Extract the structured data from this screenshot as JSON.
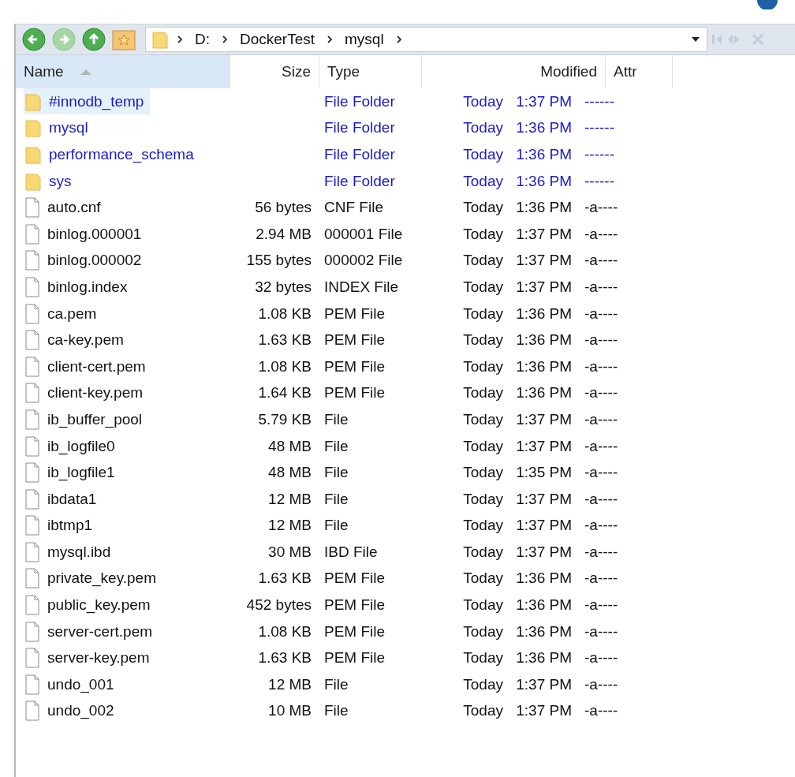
{
  "address_bar": {
    "segments": [
      "D:",
      "DockerTest",
      "mysql"
    ]
  },
  "columns": [
    {
      "label": "Name",
      "sorted": true
    },
    {
      "label": "Size",
      "sorted": false
    },
    {
      "label": "Type",
      "sorted": false
    },
    {
      "label": "Modified",
      "sorted": false
    },
    {
      "label": "Attr",
      "sorted": false
    }
  ],
  "rows": [
    {
      "kind": "folder",
      "name": "#innodb_temp",
      "size": "",
      "type": "File Folder",
      "date": "Today",
      "time": "1:37 PM",
      "attr": "------",
      "selected": true
    },
    {
      "kind": "folder",
      "name": "mysql",
      "size": "",
      "type": "File Folder",
      "date": "Today",
      "time": "1:36 PM",
      "attr": "------",
      "selected": false
    },
    {
      "kind": "folder",
      "name": "performance_schema",
      "size": "",
      "type": "File Folder",
      "date": "Today",
      "time": "1:36 PM",
      "attr": "------",
      "selected": false
    },
    {
      "kind": "folder",
      "name": "sys",
      "size": "",
      "type": "File Folder",
      "date": "Today",
      "time": "1:36 PM",
      "attr": "------",
      "selected": false
    },
    {
      "kind": "file",
      "name": "auto.cnf",
      "size": "56 bytes",
      "type": "CNF File",
      "date": "Today",
      "time": "1:36 PM",
      "attr": "-a----",
      "selected": false
    },
    {
      "kind": "file",
      "name": "binlog.000001",
      "size": "2.94 MB",
      "type": "000001 File",
      "date": "Today",
      "time": "1:37 PM",
      "attr": "-a----",
      "selected": false
    },
    {
      "kind": "file",
      "name": "binlog.000002",
      "size": "155 bytes",
      "type": "000002 File",
      "date": "Today",
      "time": "1:37 PM",
      "attr": "-a----",
      "selected": false
    },
    {
      "kind": "file",
      "name": "binlog.index",
      "size": "32 bytes",
      "type": "INDEX File",
      "date": "Today",
      "time": "1:37 PM",
      "attr": "-a----",
      "selected": false
    },
    {
      "kind": "file",
      "name": "ca.pem",
      "size": "1.08 KB",
      "type": "PEM File",
      "date": "Today",
      "time": "1:36 PM",
      "attr": "-a----",
      "selected": false
    },
    {
      "kind": "file",
      "name": "ca-key.pem",
      "size": "1.63 KB",
      "type": "PEM File",
      "date": "Today",
      "time": "1:36 PM",
      "attr": "-a----",
      "selected": false
    },
    {
      "kind": "file",
      "name": "client-cert.pem",
      "size": "1.08 KB",
      "type": "PEM File",
      "date": "Today",
      "time": "1:36 PM",
      "attr": "-a----",
      "selected": false
    },
    {
      "kind": "file",
      "name": "client-key.pem",
      "size": "1.64 KB",
      "type": "PEM File",
      "date": "Today",
      "time": "1:36 PM",
      "attr": "-a----",
      "selected": false
    },
    {
      "kind": "file",
      "name": "ib_buffer_pool",
      "size": "5.79 KB",
      "type": "File",
      "date": "Today",
      "time": "1:37 PM",
      "attr": "-a----",
      "selected": false
    },
    {
      "kind": "file",
      "name": "ib_logfile0",
      "size": "48 MB",
      "type": "File",
      "date": "Today",
      "time": "1:37 PM",
      "attr": "-a----",
      "selected": false
    },
    {
      "kind": "file",
      "name": "ib_logfile1",
      "size": "48 MB",
      "type": "File",
      "date": "Today",
      "time": "1:35 PM",
      "attr": "-a----",
      "selected": false
    },
    {
      "kind": "file",
      "name": "ibdata1",
      "size": "12 MB",
      "type": "File",
      "date": "Today",
      "time": "1:37 PM",
      "attr": "-a----",
      "selected": false
    },
    {
      "kind": "file",
      "name": "ibtmp1",
      "size": "12 MB",
      "type": "File",
      "date": "Today",
      "time": "1:37 PM",
      "attr": "-a----",
      "selected": false
    },
    {
      "kind": "file",
      "name": "mysql.ibd",
      "size": "30 MB",
      "type": "IBD File",
      "date": "Today",
      "time": "1:37 PM",
      "attr": "-a----",
      "selected": false
    },
    {
      "kind": "file",
      "name": "private_key.pem",
      "size": "1.63 KB",
      "type": "PEM File",
      "date": "Today",
      "time": "1:36 PM",
      "attr": "-a----",
      "selected": false
    },
    {
      "kind": "file",
      "name": "public_key.pem",
      "size": "452 bytes",
      "type": "PEM File",
      "date": "Today",
      "time": "1:36 PM",
      "attr": "-a----",
      "selected": false
    },
    {
      "kind": "file",
      "name": "server-cert.pem",
      "size": "1.08 KB",
      "type": "PEM File",
      "date": "Today",
      "time": "1:36 PM",
      "attr": "-a----",
      "selected": false
    },
    {
      "kind": "file",
      "name": "server-key.pem",
      "size": "1.63 KB",
      "type": "PEM File",
      "date": "Today",
      "time": "1:36 PM",
      "attr": "-a----",
      "selected": false
    },
    {
      "kind": "file",
      "name": "undo_001",
      "size": "12 MB",
      "type": "File",
      "date": "Today",
      "time": "1:37 PM",
      "attr": "-a----",
      "selected": false
    },
    {
      "kind": "file",
      "name": "undo_002",
      "size": "10 MB",
      "type": "File",
      "date": "Today",
      "time": "1:37 PM",
      "attr": "-a----",
      "selected": false
    }
  ]
}
